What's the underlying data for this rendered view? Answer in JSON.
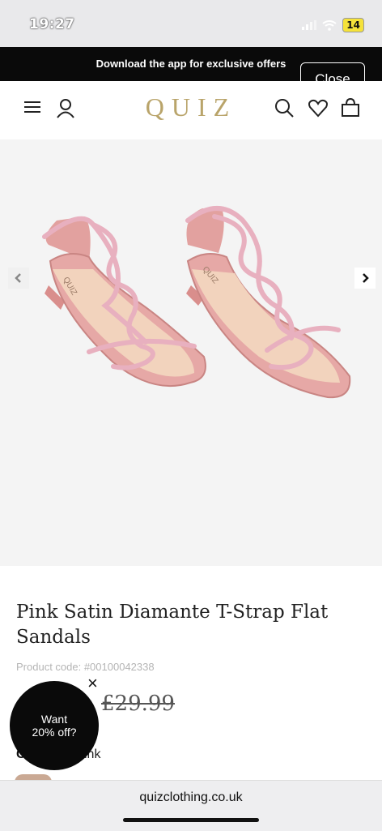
{
  "status_bar": {
    "time": "19:27",
    "battery": "14"
  },
  "promo_banner": {
    "text": "Download the app for exclusive offers",
    "close_label": "Close"
  },
  "header": {
    "logo": "QUIZ"
  },
  "product": {
    "title": "Pink Satin Diamante T-Strap Flat Sandals",
    "code": "Product code: #00100042338",
    "price": "£29.99",
    "colour_label": "C",
    "colour_value": "ink"
  },
  "offer_popup": {
    "line1": "Want",
    "line2": "20% off?",
    "close": "×"
  },
  "browser": {
    "url": "quizclothing.co.uk"
  },
  "colors": {
    "brand_gold": "#b9a46a",
    "banner_black": "#0a0a0a",
    "sandal_pink": "#e6a8a6"
  }
}
